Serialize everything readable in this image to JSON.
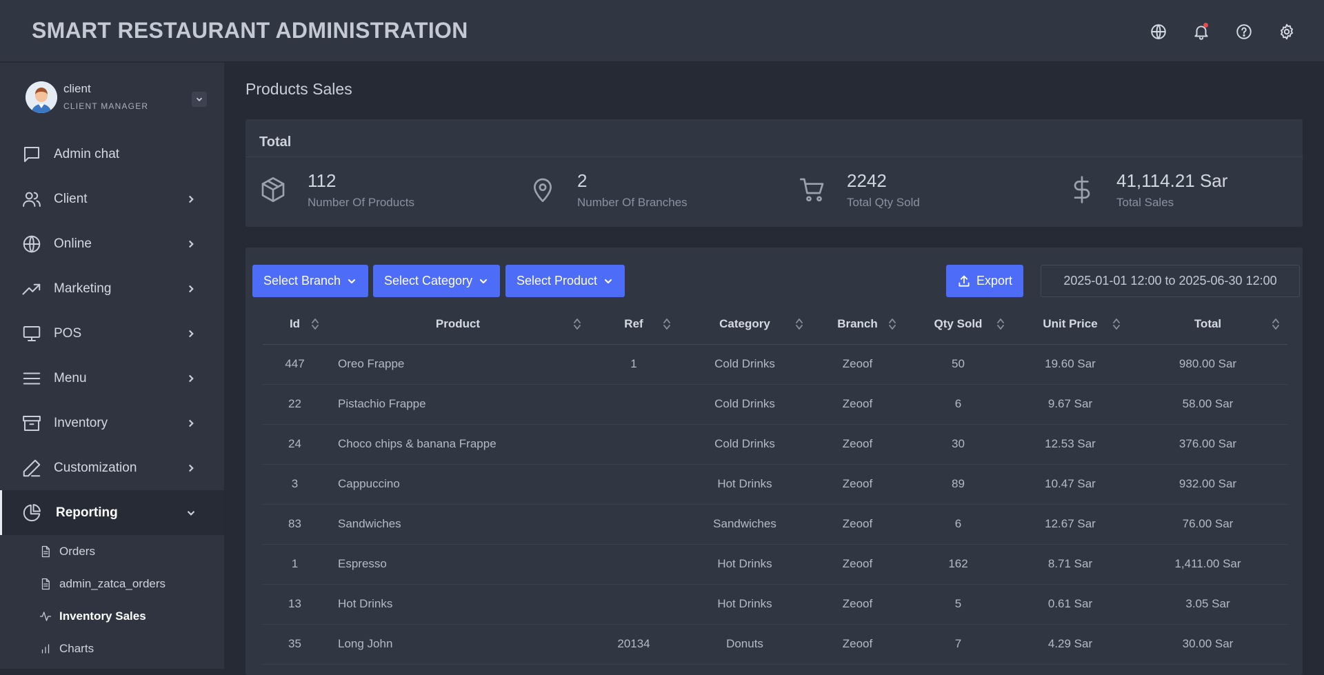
{
  "header": {
    "title": "SMART RESTAURANT ADMINISTRATION"
  },
  "user": {
    "name": "client",
    "role": "CLIENT MANAGER"
  },
  "sidebar": {
    "items": [
      {
        "label": "Admin chat"
      },
      {
        "label": "Client"
      },
      {
        "label": "Online"
      },
      {
        "label": "Marketing"
      },
      {
        "label": "POS"
      },
      {
        "label": "Menu"
      },
      {
        "label": "Inventory"
      },
      {
        "label": "Customization"
      },
      {
        "label": "Reporting"
      }
    ],
    "subitems": [
      {
        "label": "Orders"
      },
      {
        "label": "admin_zatca_orders"
      },
      {
        "label": "Inventory Sales"
      },
      {
        "label": "Charts"
      }
    ]
  },
  "page": {
    "title": "Products Sales"
  },
  "totals": {
    "heading": "Total",
    "stats": [
      {
        "value": "112",
        "label": "Number Of Products",
        "icon": "box-icon"
      },
      {
        "value": "2",
        "label": "Number Of Branches",
        "icon": "map-pin-icon"
      },
      {
        "value": "2242",
        "label": "Total Qty Sold",
        "icon": "cart-icon"
      },
      {
        "value": "41,114.21 Sar",
        "label": "Total Sales",
        "icon": "dollar-icon"
      }
    ]
  },
  "filters": {
    "branch": "Select Branch",
    "category": "Select Category",
    "product": "Select Product",
    "export": "Export",
    "date_range": "2025-01-01 12:00 to 2025-06-30 12:00"
  },
  "table": {
    "headers": [
      "Id",
      "Product",
      "Ref",
      "Category",
      "Branch",
      "Qty Sold",
      "Unit Price",
      "Total"
    ],
    "rows": [
      [
        "447",
        "Oreo Frappe",
        "1",
        "Cold Drinks",
        "Zeoof",
        "50",
        "19.60 Sar",
        "980.00 Sar"
      ],
      [
        "22",
        "Pistachio Frappe",
        "",
        "Cold Drinks",
        "Zeoof",
        "6",
        "9.67 Sar",
        "58.00 Sar"
      ],
      [
        "24",
        "Choco chips & banana Frappe",
        "",
        "Cold Drinks",
        "Zeoof",
        "30",
        "12.53 Sar",
        "376.00 Sar"
      ],
      [
        "3",
        "Cappuccino",
        "",
        "Hot Drinks",
        "Zeoof",
        "89",
        "10.47 Sar",
        "932.00 Sar"
      ],
      [
        "83",
        "Sandwiches",
        "",
        "Sandwiches",
        "Zeoof",
        "6",
        "12.67 Sar",
        "76.00 Sar"
      ],
      [
        "1",
        "Espresso",
        "",
        "Hot Drinks",
        "Zeoof",
        "162",
        "8.71 Sar",
        "1,411.00 Sar"
      ],
      [
        "13",
        "Hot Drinks",
        "",
        "Hot Drinks",
        "Zeoof",
        "5",
        "0.61 Sar",
        "3.05 Sar"
      ],
      [
        "35",
        "Long John",
        "20134",
        "Donuts",
        "Zeoof",
        "7",
        "4.29 Sar",
        "30.00 Sar"
      ]
    ]
  }
}
